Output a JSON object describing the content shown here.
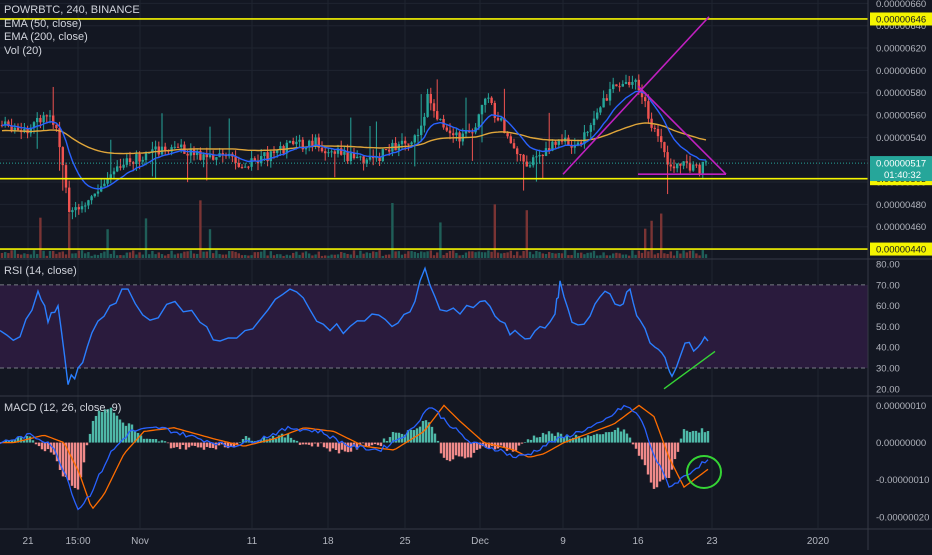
{
  "header": {
    "symbol_line": "POWRBTC, 240, BINANCE",
    "ema50": "EMA (50, close)",
    "ema200": "EMA (200, close)",
    "vol": "Vol (20)"
  },
  "panes": {
    "rsi_label": "RSI (14, close)",
    "macd_label": "MACD (12, 26, close, 9)"
  },
  "colors": {
    "background": "#131722",
    "grid": "#1f2430",
    "up": "#26a69a",
    "down": "#ef5350",
    "ema50": "#2962ff",
    "ema200": "#e0a63a",
    "level": "#f5f500",
    "pattern": "#c020c0",
    "rsi": "#2a7fff",
    "rsi_band": "#2a1b3d",
    "rsi_trend": "#35d435",
    "macd": "#2962ff",
    "signal": "#ff6d00",
    "circle": "#35d435",
    "price_tag": "#26a69a"
  },
  "chart_data": [
    {
      "type": "candlestick",
      "title": "POWRBTC, 240, BINANCE",
      "x_ticks": [
        "21",
        "15:00",
        "Nov",
        "11",
        "18",
        "25",
        "Dec",
        "9",
        "16",
        "23",
        "2020"
      ],
      "y_ticks": [
        "0.00000660",
        "0.00000640",
        "0.00000620",
        "0.00000600",
        "0.00000580",
        "0.00000560",
        "0.00000540",
        "0.00000520",
        "0.00000500",
        "0.00000480",
        "0.00000460"
      ],
      "ylim": [
        4.32e-06,
        6.63e-06
      ],
      "horizontal_levels": [
        "0.00000646",
        "0.00000503",
        "0.00000440"
      ],
      "current_price": "0.00000517",
      "countdown": "01:40:32",
      "series": [
        {
          "name": "EMA (50, close)"
        },
        {
          "name": "EMA (200, close)"
        },
        {
          "name": "Vol (20)"
        }
      ],
      "trendlines": [
        {
          "from": [
            "9",
            5.07e-06
          ],
          "to": [
            "23",
            6.48e-06
          ]
        },
        {
          "from": [
            "16",
            5.86e-06
          ],
          "to": [
            "23",
            5.07e-06
          ]
        },
        {
          "from": [
            "16",
            5.07e-06
          ],
          "to": [
            "23",
            5.07e-06
          ]
        }
      ]
    },
    {
      "type": "line",
      "title": "RSI (14, close)",
      "y_ticks": [
        "80.00",
        "70.00",
        "60.00",
        "50.00",
        "40.00",
        "30.00",
        "20.00"
      ],
      "ylim": [
        17,
        82
      ],
      "band": [
        30,
        70
      ]
    },
    {
      "type": "line",
      "title": "MACD (12, 26, close, 9)",
      "y_ticks": [
        "0.00000010",
        "0.00000000",
        "-0.00000010",
        "-0.00000020"
      ],
      "ylim": [
        -2.3e-07,
        1.2e-07
      ]
    }
  ]
}
